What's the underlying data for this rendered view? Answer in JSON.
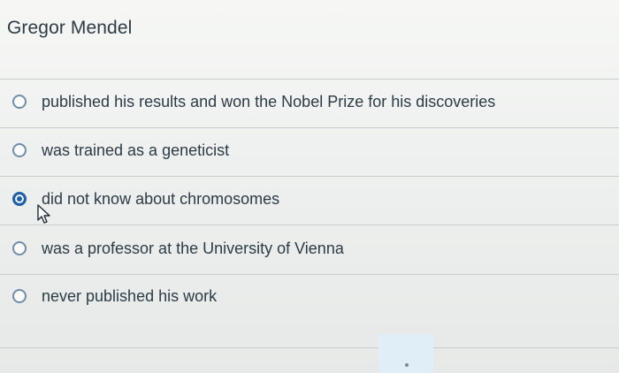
{
  "question": {
    "title": "Gregor Mendel"
  },
  "options": [
    {
      "label": "published his results and won the Nobel Prize for his discoveries",
      "selected": false
    },
    {
      "label": "was trained as a geneticist",
      "selected": false
    },
    {
      "label": "did not know about chromosomes",
      "selected": true
    },
    {
      "label": "was a professor at the University of Vienna",
      "selected": false
    },
    {
      "label": "never published his work",
      "selected": false
    }
  ],
  "colors": {
    "text": "#2d3b45",
    "radio_border": "#6f8ea6",
    "radio_selected": "#1f5fa8",
    "divider": "#c9cdcf"
  },
  "icons": {
    "cursor": "mouse-pointer-icon"
  }
}
